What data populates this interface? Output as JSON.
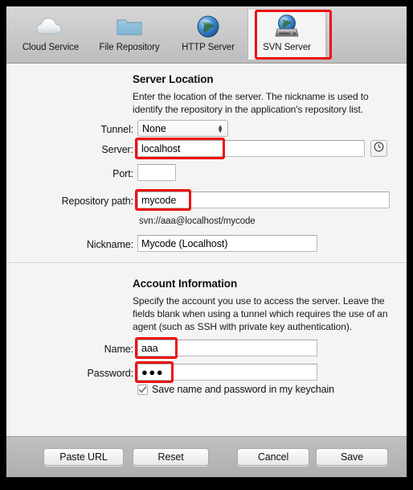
{
  "toolbar": {
    "tabs": [
      {
        "label": "Cloud Service",
        "icon": "cloud-icon",
        "selected": false
      },
      {
        "label": "File Repository",
        "icon": "folder-icon",
        "selected": false
      },
      {
        "label": "HTTP Server",
        "icon": "globe-icon",
        "selected": false
      },
      {
        "label": "SVN Server",
        "icon": "globe-harddrive-icon",
        "selected": true
      }
    ]
  },
  "server_location": {
    "title": "Server Location",
    "description": "Enter the location of the server. The nickname is used to identify the repository in the application's repository list.",
    "tunnel_label": "Tunnel:",
    "tunnel_value": "None",
    "server_label": "Server:",
    "server_value": "localhost",
    "server_history_icon": "clock-icon",
    "port_label": "Port:",
    "port_value": "",
    "repository_path_label": "Repository path:",
    "repository_path_value": "mycode",
    "url_preview": "svn://aaa@localhost/mycode",
    "nickname_label": "Nickname:",
    "nickname_value": "Mycode (Localhost)"
  },
  "account_information": {
    "title": "Account Information",
    "description": "Specify the account you use to access the server. Leave the fields blank when using a tunnel which requires the use of an agent (such as SSH with private key authentication).",
    "name_label": "Name:",
    "name_value": "aaa",
    "password_label": "Password:",
    "password_value": "●●●",
    "keychain_label": "Save name and password in my keychain",
    "keychain_checked": true
  },
  "buttons": {
    "paste_url": "Paste URL",
    "reset": "Reset",
    "cancel": "Cancel",
    "save": "Save"
  },
  "annotations": {
    "color": "#ee1111",
    "boxes": [
      "svn-server-tab",
      "server-field",
      "repository-path-field",
      "name-field",
      "password-field"
    ]
  }
}
